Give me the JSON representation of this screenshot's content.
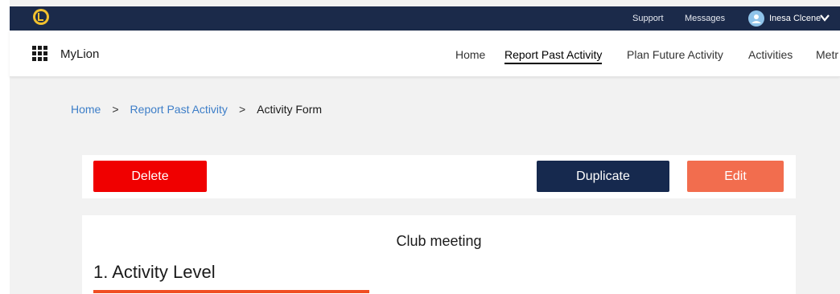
{
  "topbar": {
    "support_label": "Support",
    "messages_label": "Messages",
    "user_name": "Inesa Clcene",
    "colors": {
      "background": "#1b2a4a",
      "avatar": "#8fc3ea"
    }
  },
  "navbar": {
    "brand": "MyLion",
    "items": [
      {
        "label": "Home",
        "active": false
      },
      {
        "label": "Report Past Activity",
        "active": true
      },
      {
        "label": "Plan Future Activity",
        "active": false
      },
      {
        "label": "Activities",
        "active": false
      },
      {
        "label": "Metr",
        "active": false
      }
    ]
  },
  "breadcrumb": {
    "items": [
      "Home",
      "Report Past Activity",
      "Activity Form"
    ],
    "separator": ">"
  },
  "actions": {
    "delete_label": "Delete",
    "duplicate_label": "Duplicate",
    "edit_label": "Edit",
    "colors": {
      "delete": "#f00000",
      "duplicate": "#16294e",
      "edit": "#f26d4e"
    }
  },
  "form": {
    "title": "Club meeting",
    "section_heading": "1. Activity Level",
    "accent_color": "#f04e23"
  }
}
